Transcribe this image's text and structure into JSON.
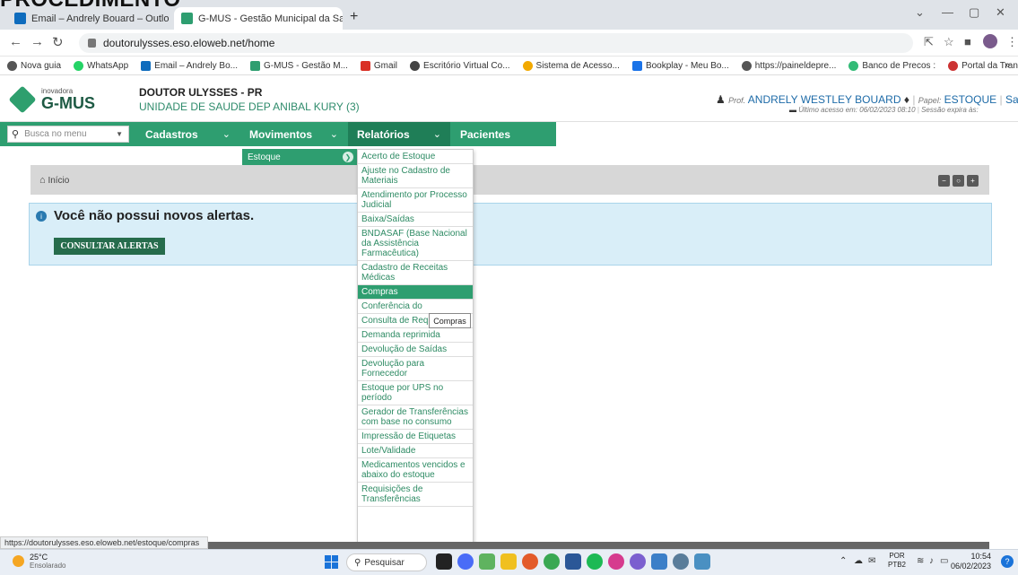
{
  "overlay_heading": "PROCEDIMENTO",
  "browser": {
    "tabs": [
      {
        "title": "Email – Andrely Bouard – Outlo",
        "color": "#0f6cbd"
      },
      {
        "title": "G-MUS - Gestão Municipal da Sa",
        "color": "#2e9e70"
      }
    ],
    "new_tab": "+",
    "url": "doutorulysses.eso.eloweb.net/home",
    "bookmarks": [
      {
        "label": "Nova guia",
        "color": "#555"
      },
      {
        "label": "WhatsApp",
        "color": "#25d366"
      },
      {
        "label": "Email – Andrely Bo...",
        "color": "#0f6cbd"
      },
      {
        "label": "G-MUS - Gestão M...",
        "color": "#2e9e70"
      },
      {
        "label": "Gmail",
        "color": "#d93025"
      },
      {
        "label": "Escritório Virtual Co...",
        "color": "#444"
      },
      {
        "label": "Sistema de Acesso...",
        "color": "#f2a900"
      },
      {
        "label": "Bookplay - Meu Bo...",
        "color": "#1a73e8"
      },
      {
        "label": "https://paineldepre...",
        "color": "#555"
      },
      {
        "label": "Banco de Precos :",
        "color": "#3b7"
      },
      {
        "label": "Portal da Transparê...",
        "color": "#c33"
      }
    ],
    "bookmarks_more": "»"
  },
  "header": {
    "logo_small": "inovadora",
    "logo_big": "G-MUS",
    "city": "DOUTOR ULYSSES - PR",
    "unit": "UNIDADE DE SAUDE DEP ANIBAL KURY (3)",
    "prof_label": "Prof.",
    "user_name": "ANDRELY WESTLEY BOUARD",
    "role_label": "Papel:",
    "role": "ESTOQUE",
    "logout": "Sair",
    "last_access": "Último acesso em: 06/02/2023 08:10",
    "session": "Sessão expira às:"
  },
  "menu": {
    "search_placeholder": "Busca no menu",
    "items": [
      "Cadastros",
      "Movimentos",
      "Relatórios",
      "Pacientes"
    ],
    "chevron": "⌄"
  },
  "submenu": {
    "estoque": "Estoque"
  },
  "dropdown": {
    "items": [
      "Acerto de Estoque",
      "Ajuste no Cadastro de Materiais",
      "Atendimento por Processo Judicial",
      "Baixa/Saídas",
      "BNDASAF (Base Nacional da Assistência Farmacêutica)",
      "Cadastro de Receitas Médicas",
      "Compras",
      "Conferência do",
      "Consulta de Requisições",
      "Demanda reprimida",
      "Devolução de Saídas",
      "Devolução para Fornecedor",
      "Estoque por UPS no período",
      "Gerador de Transferências com base no consumo",
      "Impressão de Etiquetas",
      "Lote/Validade",
      "Medicamentos vencidos e abaixo do estoque",
      "Requisições de Transferências"
    ],
    "active_index": 6,
    "tooltip": "Compras"
  },
  "breadcrumb": {
    "home": "Início"
  },
  "alerts": {
    "title": "Você não possui novos alertas.",
    "button": "CONSULTAR ALERTAS"
  },
  "status_url": "https://doutorulysses.eso.eloweb.net/estoque/compras",
  "taskbar": {
    "temp": "25°C",
    "weather": "Ensolarado",
    "search": "Pesquisar",
    "lang1": "POR",
    "lang2": "PTB2",
    "time": "10:54",
    "date": "06/02/2023"
  }
}
